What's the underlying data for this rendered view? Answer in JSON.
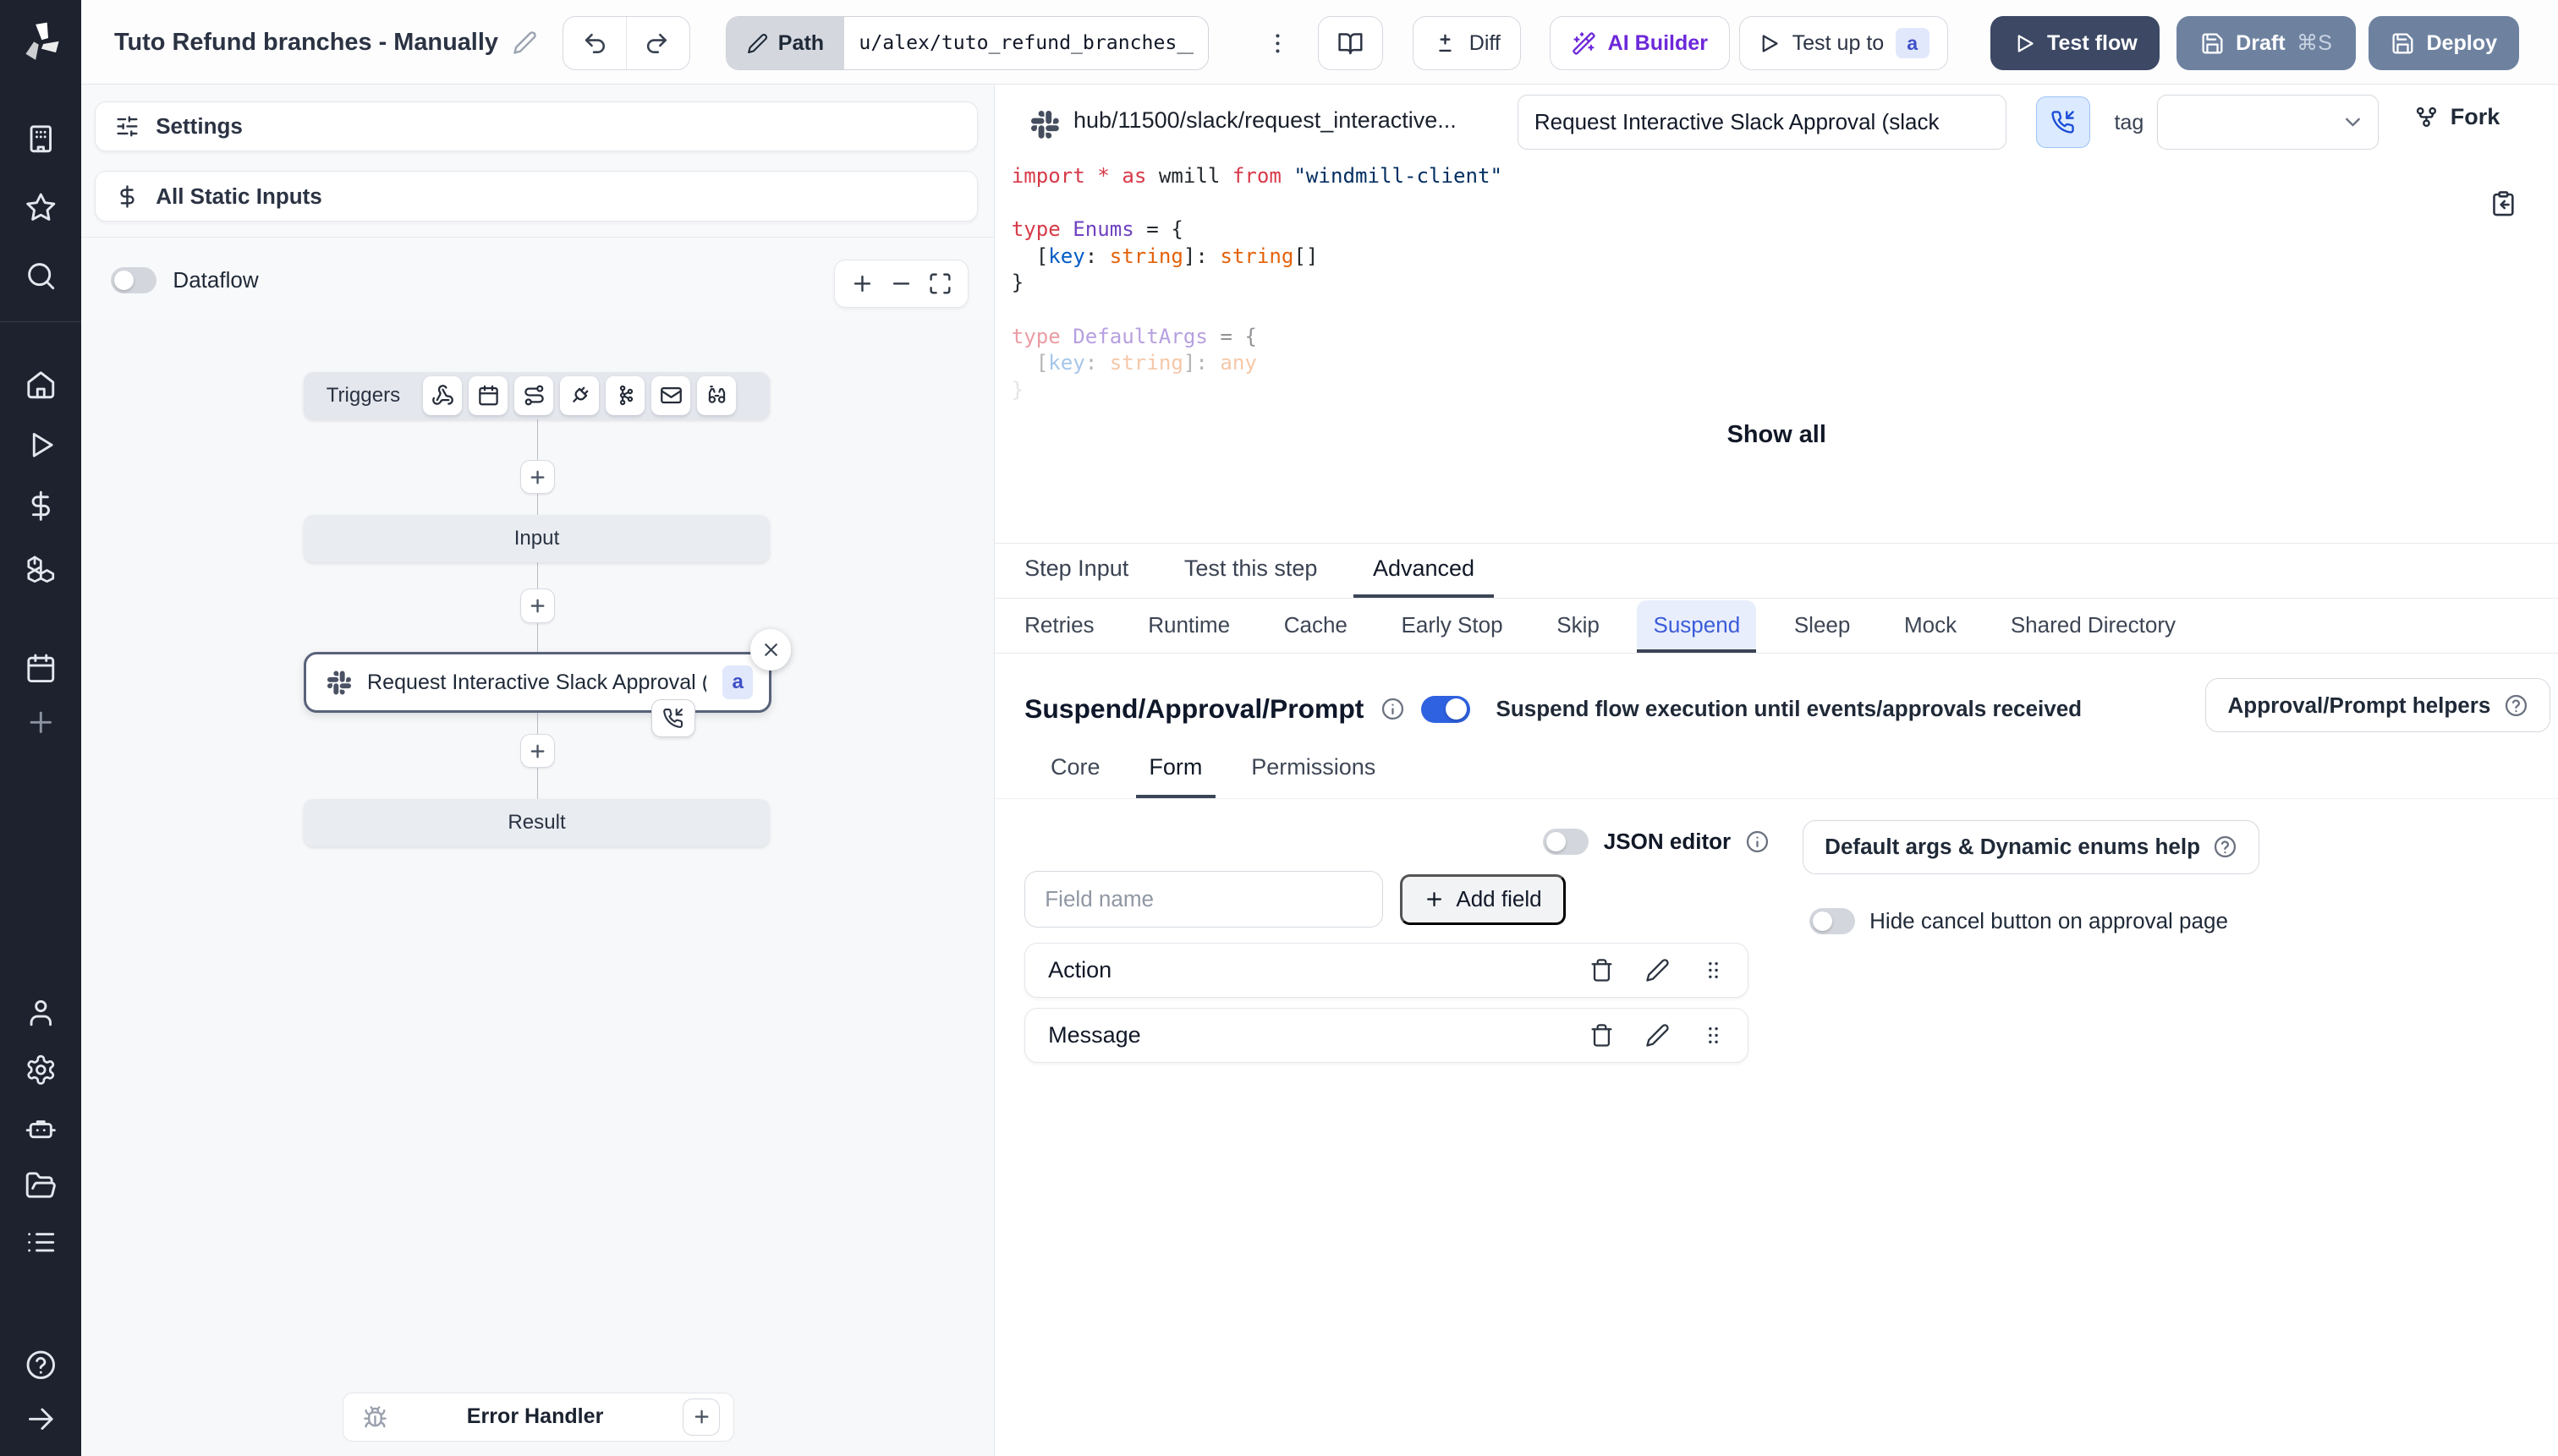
{
  "topbar": {
    "title": "Tuto Refund branches - Manually",
    "path_label": "Path",
    "path_value": "u/alex/tuto_refund_branches__",
    "diff_label": "Diff",
    "ai_builder_label": "AI Builder",
    "test_up_to_label": "Test up to",
    "test_up_to_badge": "a",
    "test_flow_label": "Test flow",
    "draft_label": "Draft",
    "draft_shortcut": "⌘S",
    "deploy_label": "Deploy"
  },
  "left": {
    "settings_label": "Settings",
    "all_static_inputs_label": "All Static Inputs",
    "dataflow_label": "Dataflow"
  },
  "graph": {
    "triggers_label": "Triggers",
    "input_label": "Input",
    "step_label": "Request Interactive Slack Approval (...",
    "step_badge": "a",
    "result_label": "Result",
    "error_handler_label": "Error Handler"
  },
  "right": {
    "header": {
      "hub_path": "hub/11500/slack/request_interactive...",
      "summary_value": "Request Interactive Slack Approval (slack",
      "tag_label": "tag",
      "fork_label": "Fork"
    },
    "code": {
      "lines": [
        {
          "tokens": [
            {
              "t": "import",
              "c": "kw"
            },
            {
              "t": " ",
              "c": "pl"
            },
            {
              "t": "*",
              "c": "kw"
            },
            {
              "t": " ",
              "c": "pl"
            },
            {
              "t": "as",
              "c": "kw"
            },
            {
              "t": " wmill ",
              "c": "pl"
            },
            {
              "t": "from",
              "c": "kw"
            },
            {
              "t": " ",
              "c": "pl"
            },
            {
              "t": "\"windmill-client\"",
              "c": "str"
            }
          ]
        },
        {
          "tokens": []
        },
        {
          "tokens": [
            {
              "t": "type",
              "c": "kw"
            },
            {
              "t": " ",
              "c": "pl"
            },
            {
              "t": "Enums",
              "c": "ty"
            },
            {
              "t": " = {",
              "c": "pl"
            }
          ]
        },
        {
          "tokens": [
            {
              "t": "  [",
              "c": "pl"
            },
            {
              "t": "key",
              "c": "pr"
            },
            {
              "t": ": ",
              "c": "pl"
            },
            {
              "t": "string",
              "c": "bi"
            },
            {
              "t": "]: ",
              "c": "pl"
            },
            {
              "t": "string",
              "c": "bi"
            },
            {
              "t": "[]",
              "c": "pl"
            }
          ]
        },
        {
          "tokens": [
            {
              "t": "}",
              "c": "pl"
            }
          ]
        },
        {
          "tokens": []
        },
        {
          "opacity": 0.5,
          "tokens": [
            {
              "t": "type",
              "c": "kw"
            },
            {
              "t": " ",
              "c": "pl"
            },
            {
              "t": "DefaultArgs",
              "c": "ty"
            },
            {
              "t": " = {",
              "c": "pl"
            }
          ]
        },
        {
          "opacity": 0.35,
          "tokens": [
            {
              "t": "  [",
              "c": "pl"
            },
            {
              "t": "key",
              "c": "pr"
            },
            {
              "t": ": ",
              "c": "pl"
            },
            {
              "t": "string",
              "c": "bi"
            },
            {
              "t": "]: ",
              "c": "pl"
            },
            {
              "t": "any",
              "c": "bi"
            }
          ]
        },
        {
          "opacity": 0.12,
          "tokens": [
            {
              "t": "}",
              "c": "pl"
            }
          ]
        }
      ]
    },
    "show_all_label": "Show all",
    "tabs": [
      "Step Input",
      "Test this step",
      "Advanced"
    ],
    "advanced_tabs": [
      "Retries",
      "Runtime",
      "Cache",
      "Early Stop",
      "Skip",
      "Suspend",
      "Sleep",
      "Mock",
      "Shared Directory"
    ],
    "suspend": {
      "title": "Suspend/Approval/Prompt",
      "description": "Suspend flow execution until events/approvals received",
      "helpers_button_label": "Approval/Prompt helpers"
    },
    "detail_tabs": [
      "Core",
      "Form",
      "Permissions"
    ],
    "form": {
      "json_editor_label": "JSON editor",
      "default_args_button_label": "Default args & Dynamic enums help",
      "field_name_placeholder": "Field name",
      "add_field_label": "Add field",
      "hide_cancel_label": "Hide cancel button on approval page",
      "fields": [
        {
          "name": "Action"
        },
        {
          "name": "Message"
        }
      ]
    }
  },
  "colors": {
    "toggle_on": "#2f62e0",
    "suspend_tab_active": "#3a5bd9",
    "sidebar_bg": "#1d222e",
    "test_flow_bg": "#3c4864",
    "deploy_bg": "#6e82a0",
    "ai_builder_purple": "#6d28d9"
  }
}
